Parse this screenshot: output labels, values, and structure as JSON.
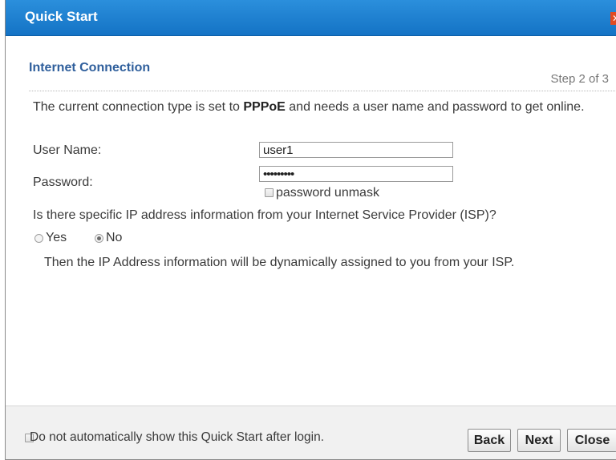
{
  "dialog": {
    "title": "Quick Start",
    "close_glyph": "✕"
  },
  "section": {
    "title": "Internet Connection",
    "step": "Step 2 of 3"
  },
  "intro": {
    "before": "The current connection type is set to ",
    "connection_type": "PPPoE",
    "after": " and needs a user name and password to get online."
  },
  "form": {
    "user_name_label": "User Name:",
    "user_name_value": "user1",
    "password_label": "Password:",
    "password_value": "password1",
    "unmask_label": "password unmask",
    "unmask_checked": false
  },
  "isp": {
    "question": "Is there specific IP address information from your Internet Service Provider (ISP)?",
    "yes_label": "Yes",
    "no_label": "No",
    "selected": "No",
    "info": "Then the IP Address information will be dynamically assigned to you from your ISP."
  },
  "footer": {
    "auto_show_label": "Do not automatically show this Quick Start after login.",
    "auto_show_checked": false,
    "back_label": "Back",
    "next_label": "Next",
    "close_label": "Close"
  },
  "colors": {
    "title_bar": "#1f82d2",
    "section_title": "#2f5f9c",
    "close_icon": "#e14a22"
  }
}
